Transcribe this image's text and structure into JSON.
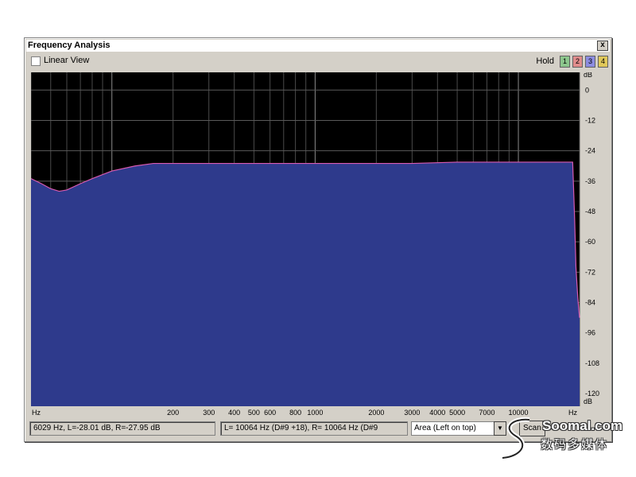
{
  "window": {
    "title": "Frequency Analysis",
    "close_glyph": "x"
  },
  "toolbar": {
    "linear_view_label": "Linear View",
    "linear_view_checked": false,
    "hold_label": "Hold",
    "hold_buttons": [
      {
        "label": "1",
        "color": "#8cc68c"
      },
      {
        "label": "2",
        "color": "#e08c8c"
      },
      {
        "label": "3",
        "color": "#8c8ce0"
      },
      {
        "label": "4",
        "color": "#e0c85a"
      }
    ]
  },
  "chart_data": {
    "type": "area",
    "x_scale": "log",
    "x_unit": "Hz",
    "y_unit": "dB",
    "xlim": [
      40,
      20000
    ],
    "ylim": [
      -125,
      7
    ],
    "x_ticks": [
      {
        "value": 200,
        "label": "200"
      },
      {
        "value": 300,
        "label": "300"
      },
      {
        "value": 400,
        "label": "400"
      },
      {
        "value": 500,
        "label": "500"
      },
      {
        "value": 600,
        "label": "600"
      },
      {
        "value": 800,
        "label": "800"
      },
      {
        "value": 1000,
        "label": "1000"
      },
      {
        "value": 2000,
        "label": "2000"
      },
      {
        "value": 3000,
        "label": "3000"
      },
      {
        "value": 4000,
        "label": "4000"
      },
      {
        "value": 5000,
        "label": "5000"
      },
      {
        "value": 7000,
        "label": "7000"
      },
      {
        "value": 10000,
        "label": "10000"
      }
    ],
    "y_ticks": [
      0,
      -12,
      -24,
      -36,
      -48,
      -60,
      -72,
      -84,
      -96,
      -108,
      -120
    ],
    "series": [
      {
        "fill": "#2e3a8c",
        "stroke": "#d85ab0",
        "x": [
          40,
          45,
          50,
          55,
          60,
          70,
          80,
          100,
          130,
          160,
          200,
          300,
          500,
          1000,
          2000,
          3000,
          5000,
          8000,
          10000,
          14000,
          18500,
          18900,
          19200,
          19600,
          20000
        ],
        "y": [
          -35,
          -37,
          -39,
          -40,
          -39.5,
          -37,
          -35,
          -32,
          -30,
          -29,
          -29,
          -29,
          -29,
          -29,
          -29,
          -29,
          -28.5,
          -28.5,
          -28.5,
          -28.5,
          -28.5,
          -50,
          -70,
          -82,
          -90
        ]
      }
    ]
  },
  "plot_labels": {
    "x_axis_left": "Hz",
    "x_axis_right": "Hz",
    "y_axis_top": "dB",
    "y_axis_bottom": "dB"
  },
  "status": {
    "cursor_readout": "6029 Hz, L=-28.01 dB, R=-27.95 dB",
    "peak_readout": "L=  10064 Hz (D#9 +18), R=  10064 Hz (D#9",
    "display_mode": "Area (Left on top)",
    "scan_label": "Scan"
  },
  "watermark": {
    "line1": "Soomal.com",
    "line2": "数码多媒体"
  }
}
